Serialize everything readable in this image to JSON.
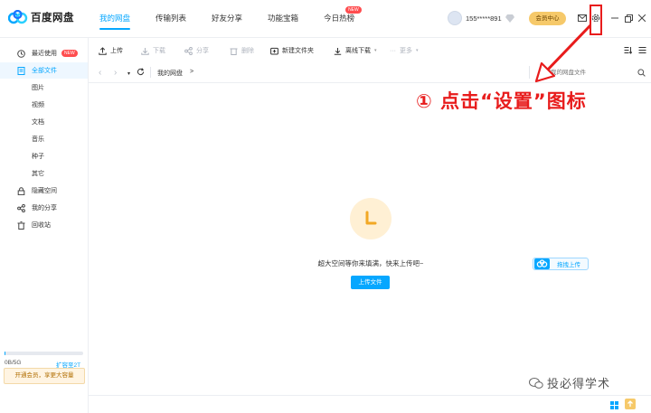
{
  "app": {
    "logo_text": "百度网盘"
  },
  "header": {
    "tabs": [
      {
        "label": "我的网盘",
        "active": true
      },
      {
        "label": "传输列表"
      },
      {
        "label": "好友分享"
      },
      {
        "label": "功能宝箱"
      },
      {
        "label": "今日热榜",
        "badge": "NEW"
      }
    ],
    "username": "155*****891",
    "vip_label": "会员中心"
  },
  "sidebar": {
    "items": [
      {
        "label": "最近使用",
        "badge": "NEW",
        "icon": "clock-icon"
      },
      {
        "label": "全部文件",
        "icon": "file-icon",
        "active": true
      },
      {
        "label": "图片"
      },
      {
        "label": "视频"
      },
      {
        "label": "文档"
      },
      {
        "label": "音乐"
      },
      {
        "label": "种子"
      },
      {
        "label": "其它"
      },
      {
        "label": "隐藏空间",
        "icon": "lock-icon"
      },
      {
        "label": "我的分享",
        "icon": "share-icon"
      },
      {
        "label": "回收站",
        "icon": "trash-icon"
      }
    ],
    "promo": "开通会员，享更大容量",
    "quota": "0B/5G",
    "quota_link": "扩容至2T",
    "quota_used_fraction": 0.01
  },
  "toolbar": {
    "upload": "上传",
    "download": "下载",
    "share": "分享",
    "delete": "删除",
    "new_folder": "新建文件夹",
    "offline": "离线下载",
    "more": "更多"
  },
  "address": {
    "breadcrumb": "我的网盘",
    "sep": ">",
    "search_placeholder": "搜索我的网盘文件"
  },
  "annotation": {
    "text": "① 点击“设置”图标"
  },
  "empty": {
    "message": "超大空间等你来填满，快来上传吧~",
    "upload_button": "上传文件",
    "drag_label": "拖拽上传"
  },
  "watermark": "投必得学术",
  "colors": {
    "accent": "#06a7ff",
    "annotation": "#e81c1c",
    "vip": "#f6c96a"
  }
}
